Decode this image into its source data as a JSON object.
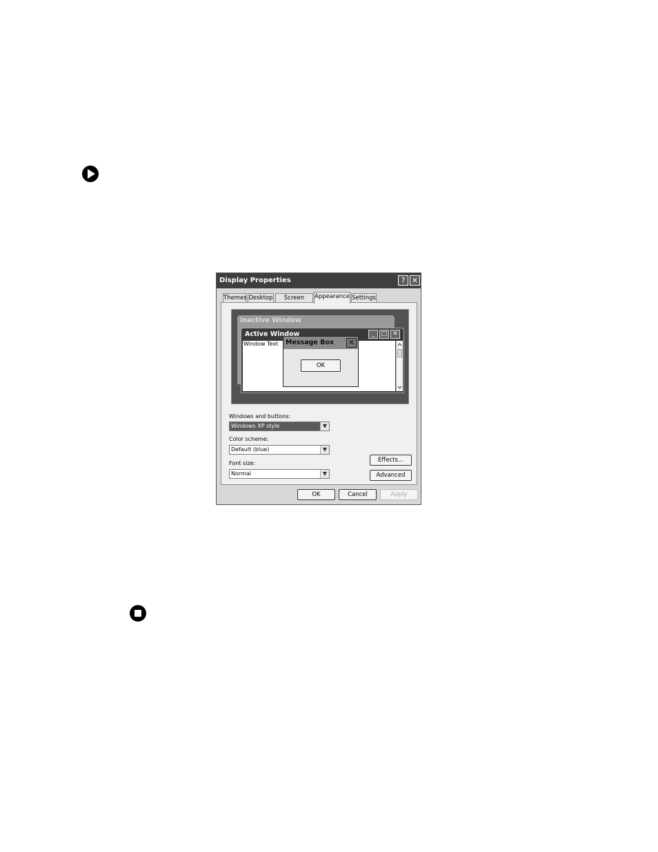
{
  "dialog": {
    "title": "Display Properties",
    "help_glyph": "?",
    "close_glyph": "✕",
    "tabs": [
      {
        "label": "Themes"
      },
      {
        "label": "Desktop"
      },
      {
        "label": "Screen Saver"
      },
      {
        "label": "Appearance"
      },
      {
        "label": "Settings"
      }
    ],
    "active_tab": "Appearance",
    "preview": {
      "inactive_title": "Inactive Window",
      "active_title": "Active Window",
      "window_text": "Window Text",
      "message_box_title": "Message Box",
      "message_ok": "OK"
    },
    "windows_buttons_label": "Windows and buttons:",
    "windows_buttons_value": "Windows XP style",
    "color_scheme_label": "Color scheme:",
    "color_scheme_value": "Default (blue)",
    "font_size_label": "Font size:",
    "font_size_value": "Normal",
    "effects_label": "Effects...",
    "advanced_label": "Advanced",
    "ok_label": "OK",
    "cancel_label": "Cancel",
    "apply_label": "Apply"
  },
  "icons": [
    "play-arrow-icon",
    "stop-square-icon"
  ]
}
